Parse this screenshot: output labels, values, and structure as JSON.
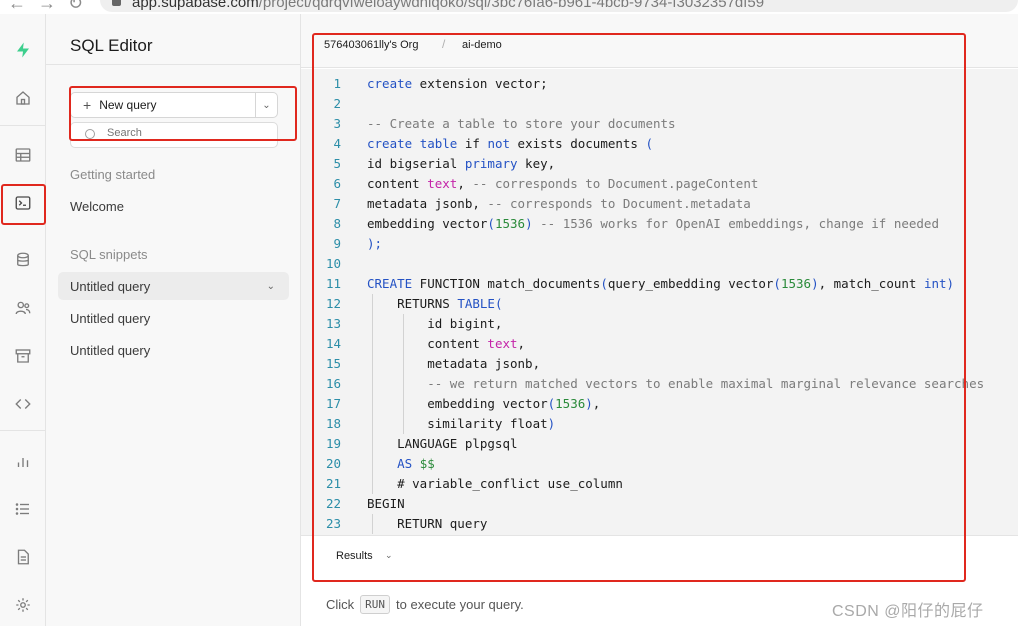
{
  "browser": {
    "url_host": "app.supabase.com",
    "url_path": "/project/qdrqvfweloaywdhiqoko/sql/3bc76fa6-b961-4bcb-9734-f3032357df59"
  },
  "sidebar": {
    "title": "SQL Editor",
    "new_query_label": "New query",
    "search_placeholder": "Search",
    "section_getting_started": "Getting started",
    "welcome_label": "Welcome",
    "section_snippets": "SQL snippets",
    "snippets": [
      "Untitled query",
      "Untitled query",
      "Untitled query"
    ]
  },
  "breadcrumb": {
    "org": "576403061lly's Org",
    "project": "ai-demo"
  },
  "editor": {
    "line_numbers": [
      "1",
      "2",
      "3",
      "4",
      "5",
      "6",
      "7",
      "8",
      "9",
      "10",
      "11",
      "12",
      "13",
      "14",
      "15",
      "16",
      "17",
      "18",
      "19",
      "20",
      "21",
      "22",
      "23"
    ]
  },
  "results": {
    "label": "Results"
  },
  "hint": {
    "before": "Click",
    "key": "RUN",
    "after": "to execute your query."
  },
  "watermark": "CSDN @阳仔的屁仔",
  "colors": {
    "annotation_red": "#e0281e",
    "brand_green": "#3ecf8e",
    "keyword_blue": "#2452c4",
    "type_magenta": "#c424a8"
  }
}
